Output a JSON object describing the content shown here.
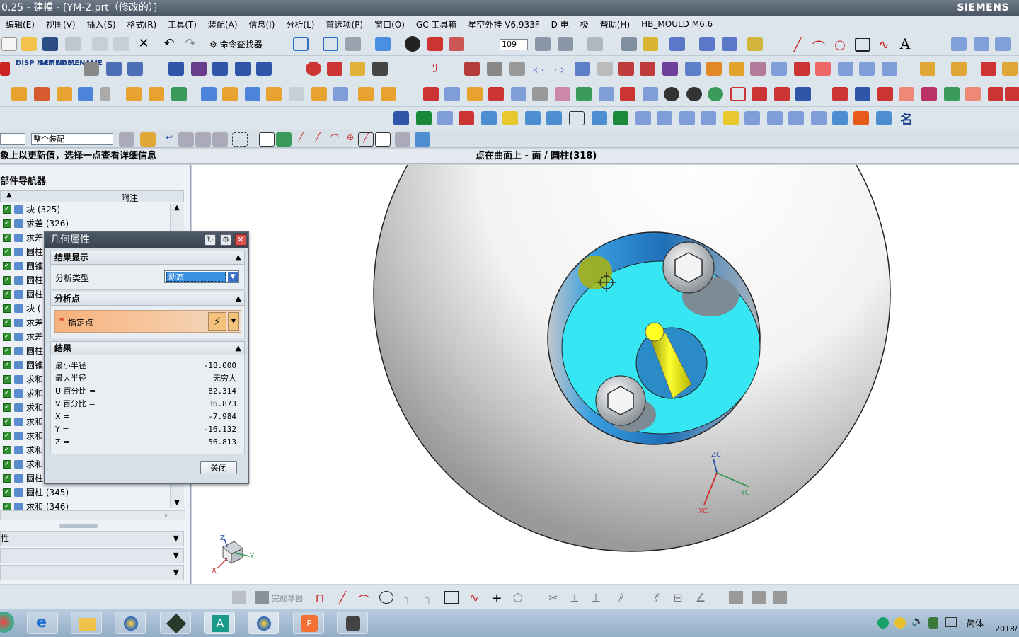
{
  "titlebar": {
    "title": "0.25 - 建模 - [YM-2.prt（修改的）]",
    "brand": "SIEMENS"
  },
  "menu": [
    "编辑(E)",
    "视图(V)",
    "插入(S)",
    "格式(R)",
    "工具(T)",
    "装配(A)",
    "信息(I)",
    "分析(L)",
    "首选项(P)",
    "窗口(O)",
    "GC 工具箱",
    "星空外挂 V6.933F",
    "D 电",
    "极",
    "帮助(H)",
    "HB_MOULD M6.6"
  ],
  "toolbar": {
    "command_finder": "命令查找器",
    "zoom_value": "109",
    "disp_name": "DISP NAME",
    "set_name": "SET NAME",
    "del_name": "DEL NAME"
  },
  "selection": {
    "scope": "整个装配"
  },
  "status": {
    "left": "象上以更新值，选择一点查看详细信息",
    "right": "点在曲面上 - 面 / 圆柱(318)"
  },
  "navigator": {
    "title": "部件导航器",
    "col_attach": "附注",
    "items": [
      {
        "label": "块 (325)"
      },
      {
        "label": "求差 (326)"
      },
      {
        "label": "求差"
      },
      {
        "label": "圆柱"
      },
      {
        "label": "圆锥"
      },
      {
        "label": "圆柱"
      },
      {
        "label": "圆柱"
      },
      {
        "label": "块 ("
      },
      {
        "label": "求差"
      },
      {
        "label": "求差"
      },
      {
        "label": "圆柱"
      },
      {
        "label": "圆锥"
      },
      {
        "label": "求和"
      },
      {
        "label": "求和"
      },
      {
        "label": "求和"
      },
      {
        "label": "求和"
      },
      {
        "label": "求和"
      },
      {
        "label": "求和"
      },
      {
        "label": "求和"
      },
      {
        "label": "圆柱"
      },
      {
        "label": "圆柱 (345)"
      },
      {
        "label": "求和 (346)"
      }
    ],
    "sections": [
      "性",
      "",
      ""
    ]
  },
  "dialog": {
    "title": "几何属性",
    "sec_display": "结果显示",
    "analysis_type_label": "分析类型",
    "analysis_type_value": "动态",
    "sec_point": "分析点",
    "point_label": "指定点",
    "required_mark": "*",
    "sec_result": "结果",
    "results": [
      {
        "k": "最小半径",
        "v": "-18.000"
      },
      {
        "k": "最大半径",
        "v": "无穷大"
      },
      {
        "k": "U 百分比 =",
        "v": "82.314"
      },
      {
        "k": "V 百分比 =",
        "v": "36.873"
      },
      {
        "k": "X =",
        "v": "-7.984"
      },
      {
        "k": "Y =",
        "v": "-16.132"
      },
      {
        "k": "Z =",
        "v": "56.813"
      }
    ],
    "close": "关闭"
  },
  "viewport": {
    "triad_zc": "ZC",
    "triad_yc": "YC",
    "triad_xc": "XC",
    "view_z": "Z",
    "view_y": "Y",
    "view_x": "X"
  },
  "sketchbar": {
    "finish_sketch": "完成草图"
  },
  "tray": {
    "ime": "简体",
    "date": "2018/"
  },
  "colors": {
    "face_cyan": "#36e6f2",
    "titlebar": "#4a5563"
  }
}
